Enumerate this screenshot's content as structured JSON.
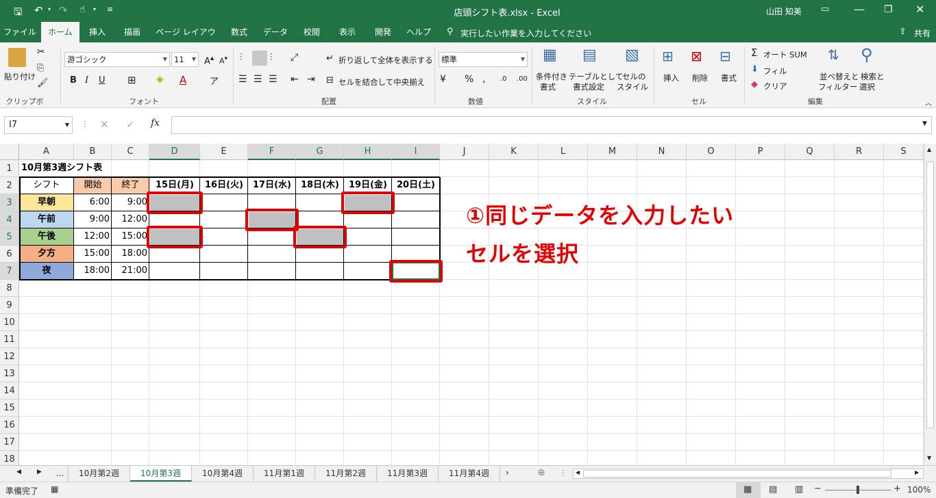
{
  "window": {
    "title": "店頭シフト表.xlsx - Excel",
    "user": "山田 知美"
  },
  "tabs": [
    "ファイル",
    "ホーム",
    "挿入",
    "描画",
    "ページ レイアウト",
    "数式",
    "データ",
    "校閲",
    "表示",
    "開発",
    "ヘルプ"
  ],
  "tell_me": "実行したい作業を入力してください",
  "share": "共有",
  "ribbon": {
    "clipboard": {
      "paste": "貼り付け",
      "label": "クリップボード"
    },
    "font": {
      "name": "游ゴシック",
      "size": "11",
      "label": "フォント",
      "bold": "B",
      "italic": "I",
      "underline": "U"
    },
    "alignment": {
      "wrap": "折り返して全体を表示する",
      "merge": "セルを結合して中央揃え",
      "label": "配置"
    },
    "number": {
      "format": "標準",
      "label": "数値"
    },
    "styles": {
      "cond": "条件付き",
      "cond2": "書式",
      "table": "テーブルとして",
      "table2": "書式設定",
      "cell": "セルの",
      "cell2": "スタイル",
      "label": "スタイル"
    },
    "cells": {
      "insert": "挿入",
      "delete": "削除",
      "format": "書式",
      "label": "セル"
    },
    "editing": {
      "autosum": "オート SUM",
      "fill": "フィル",
      "clear": "クリア",
      "sort": "並べ替えと",
      "sort2": "フィルター",
      "find": "検索と",
      "find2": "選択",
      "label": "編集"
    }
  },
  "name_box": "I7",
  "fx": "fx",
  "columns": [
    "A",
    "B",
    "C",
    "D",
    "E",
    "F",
    "G",
    "H",
    "I",
    "J",
    "K",
    "L",
    "M",
    "N",
    "O",
    "P",
    "Q",
    "R",
    "S"
  ],
  "rows": [
    "1",
    "2",
    "3",
    "4",
    "5",
    "6",
    "7",
    "8",
    "9",
    "10",
    "11",
    "12",
    "13",
    "14",
    "15",
    "16",
    "17",
    "18"
  ],
  "sheet": {
    "title": "10月第3週シフト表",
    "headers": [
      "シフト",
      "開始",
      "終了",
      "15日(月)",
      "16日(火)",
      "17日(水)",
      "18日(木)",
      "19日(金)",
      "20日(土)"
    ],
    "shifts": [
      {
        "name": "早朝",
        "start": "6:00",
        "end": "9:00",
        "color": "#ffe699"
      },
      {
        "name": "午前",
        "start": "9:00",
        "end": "12:00",
        "color": "#bdd7ee"
      },
      {
        "name": "午後",
        "start": "12:00",
        "end": "15:00",
        "color": "#a9d08e"
      },
      {
        "name": "夕方",
        "start": "15:00",
        "end": "18:00",
        "color": "#f4b084"
      },
      {
        "name": "夜",
        "start": "18:00",
        "end": "21:00",
        "color": "#8ea9db"
      }
    ],
    "header_color": "#f8cbad"
  },
  "annotation": {
    "line1": "①同じデータを入力したい",
    "line2": "セルを選択"
  },
  "sheet_tabs": [
    "...",
    "10月第2週",
    "10月第3週",
    "10月第4週",
    "11月第1週",
    "11月第2週",
    "11月第3週",
    "11月第4週"
  ],
  "active_sheet": "10月第3週",
  "status": {
    "ready": "準備完了",
    "zoom": "100%"
  }
}
